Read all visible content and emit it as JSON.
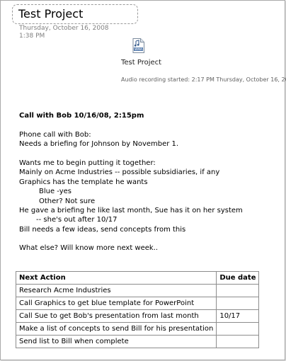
{
  "page": {
    "title": "Test Project",
    "date": "Thursday, October 16, 2008",
    "time": "1:38 PM"
  },
  "audio": {
    "icon": "wma-file-icon",
    "icon_label": "WMA",
    "title": "Test Project",
    "started": "Audio recording started: 2:17 PM Thursday, October 16, 2008"
  },
  "notes": {
    "heading": "Call with Bob 10/16/08,  2:15pm",
    "lines": [
      "Phone call with Bob:",
      "Needs a briefing for Johnson by November 1.",
      "",
      "Wants me to begin putting it together:",
      "Mainly on Acme Industries -- possible subsidiaries, if any",
      "Graphics has the template he wants",
      "Blue -yes",
      "Other? Not sure",
      "He gave a briefing he like last month, Sue has it on her system",
      "-- she's out after 10/17",
      "Bill needs a few ideas, send concepts from this",
      "",
      "What else?  Will  know more next week.."
    ]
  },
  "table": {
    "headers": [
      "Next Action",
      "Due date"
    ],
    "rows": [
      [
        "Research Acme Industries",
        ""
      ],
      [
        "Call Graphics to get blue template for PowerPoint",
        ""
      ],
      [
        "Call Sue to get Bob's presentation from last month",
        "10/17"
      ],
      [
        "Make a list of concepts to send Bill for his presentation",
        ""
      ],
      [
        "Send list to Bill  when complete",
        ""
      ]
    ]
  }
}
